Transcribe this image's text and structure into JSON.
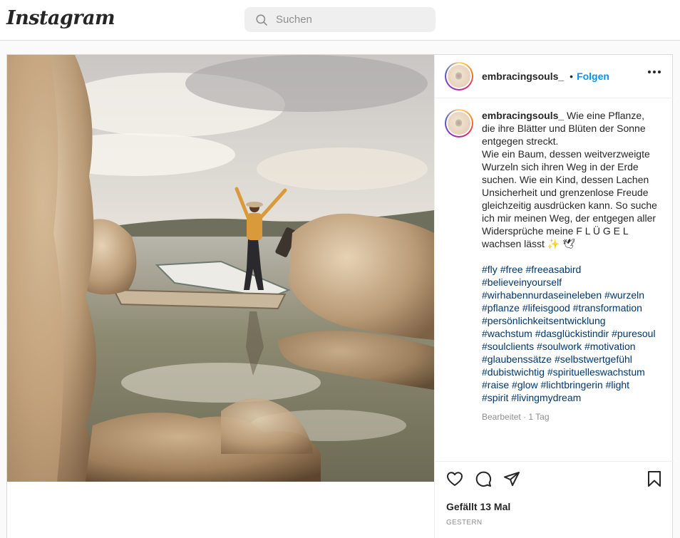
{
  "header": {
    "logo_text": "Instagram",
    "search_placeholder": "Suchen"
  },
  "post": {
    "username": "embracingsouls_",
    "separator": "•",
    "follow_label": "Folgen",
    "caption": "Wie eine Pflanze, die ihre Blätter und Blüten der Sonne entgegen streckt.\nWie ein Baum, dessen weitverzweigte Wurzeln sich ihren Weg in der Erde suchen. Wie ein Kind, dessen Lachen Unsicherheit und grenzenlose Freude gleichzeitig ausdrücken kann. So suche ich mir meinen Weg, der entgegen aller Widersprüche meine F L Ü G E L wachsen lässt ✨ 🕊",
    "hashtags": [
      "#fly",
      "#free",
      "#freeasabird",
      "#believeinyourself",
      "#wirhabennurdaseineleben",
      "#wurzeln",
      "#pflanze",
      "#lifeisgood",
      "#transformation",
      "#persönlichkeitsentwicklung",
      "#wachstum",
      "#dasglückistindir",
      "#puresoul",
      "#soulclients",
      "#soulwork",
      "#motivation",
      "#glaubenssätze",
      "#selbstwertgefühl",
      "#dubistwichtig",
      "#spirituelleswachstum",
      "#raise",
      "#glow",
      "#lichtbringerin",
      "#light",
      "#spirit",
      "#livingmydream"
    ],
    "edited_label": "Bearbeitet · 1 Tag",
    "likes_label": "Gefällt 13 Mal",
    "date_label": "GESTERN"
  },
  "icons": {
    "search": "search-icon",
    "more": "more-options-icon",
    "like": "heart-icon",
    "comment": "comment-icon",
    "share": "paper-plane-icon",
    "save": "bookmark-icon"
  },
  "colors": {
    "link_blue": "#0095f6",
    "hashtag": "#00376b",
    "muted": "#8e8e8e"
  }
}
